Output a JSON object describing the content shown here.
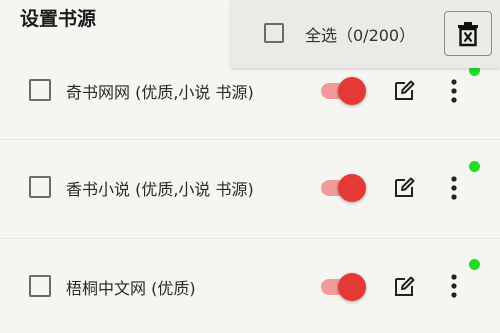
{
  "header": {
    "title": "设置书源"
  },
  "selection_bar": {
    "select_all_label": "全选（0/200）",
    "select_all_checked": false
  },
  "sources": [
    {
      "name": "奇书网网 (优质,小说 书源)",
      "checked": false,
      "enabled": true,
      "status_color": "#22dd22"
    },
    {
      "name": "香书小说 (优质,小说 书源)",
      "checked": false,
      "enabled": true,
      "status_color": "#22dd22"
    },
    {
      "name": "梧桐中文网 (优质)",
      "checked": false,
      "enabled": true,
      "status_color": "#22dd22"
    }
  ],
  "icons": {
    "delete": "delete-sweep-icon",
    "edit": "edit-icon",
    "more": "more-vertical-icon"
  },
  "colors": {
    "toggle_on": "#e53935",
    "toggle_track": "#f19b9b",
    "status": "#22dd22",
    "background": "#f5f5f1"
  }
}
